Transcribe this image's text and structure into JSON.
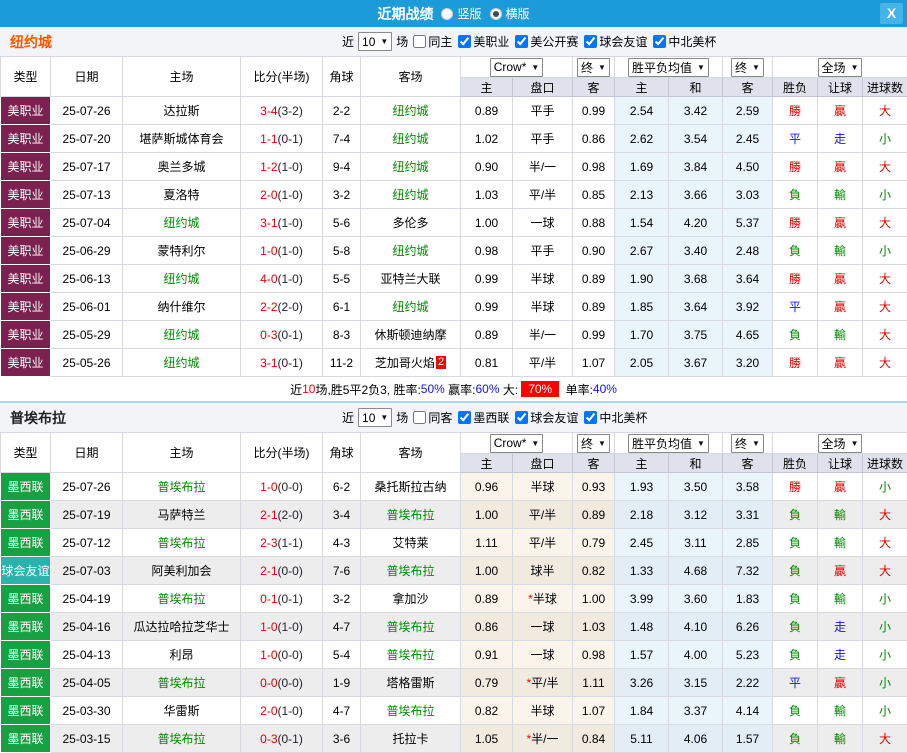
{
  "topbar": {
    "title": "近期战绩",
    "radios": [
      {
        "label": "竖版",
        "checked": false
      },
      {
        "label": "横版",
        "checked": true
      }
    ],
    "close": "X",
    "bg_color": "#1b9cd8"
  },
  "palette": {
    "r": "#e60000",
    "b": "#1414e6",
    "g": "#008a00"
  },
  "table_header": {
    "cols": [
      "类型",
      "日期",
      "主场",
      "比分(半场)",
      "角球",
      "客场"
    ],
    "sub": [
      "主",
      "盘口",
      "客",
      "主",
      "和",
      "客",
      "胜负",
      "让球",
      "进球数"
    ],
    "dropdowns": [
      "Crow*",
      "终",
      "胜平负均值",
      "终",
      "全场"
    ]
  },
  "sections": [
    {
      "team": "纽约城",
      "team_style": "color:#ff5500;",
      "filters": {
        "near": "近",
        "count": "10",
        "games": "场",
        "same_label": "同主",
        "same_checked": false,
        "comps": [
          {
            "label": "美职业",
            "checked": true
          },
          {
            "label": "美公开赛",
            "checked": true
          },
          {
            "label": "球会友谊",
            "checked": true
          },
          {
            "label": "中北美杯",
            "checked": true
          }
        ]
      },
      "rows": [
        {
          "type": "美职业",
          "type_color": "#7b2150",
          "date": "25-07-26",
          "home": "达拉斯",
          "home_self": false,
          "ft": "3-4",
          "ht": "(3-2)",
          "corner": "2-2",
          "away": "纽约城",
          "away_self": true,
          "badge": "",
          "o1": "0.89",
          "hc": "平手",
          "o2": "0.99",
          "m1": "2.54",
          "m2": "3.42",
          "m3": "2.59",
          "r": [
            [
              "勝",
              "r"
            ],
            [
              "贏",
              "r"
            ],
            [
              "大",
              "r"
            ]
          ]
        },
        {
          "type": "美职业",
          "type_color": "#7b2150",
          "date": "25-07-20",
          "home": "堪萨斯城体育会",
          "home_self": false,
          "ft": "1-1",
          "ht": "(0-1)",
          "corner": "7-4",
          "away": "纽约城",
          "away_self": true,
          "badge": "",
          "o1": "1.02",
          "hc": "平手",
          "o2": "0.86",
          "m1": "2.62",
          "m2": "3.54",
          "m3": "2.45",
          "r": [
            [
              "平",
              "b"
            ],
            [
              "走",
              "b"
            ],
            [
              "小",
              "g"
            ]
          ]
        },
        {
          "type": "美职业",
          "type_color": "#7b2150",
          "date": "25-07-17",
          "home": "奥兰多城",
          "home_self": false,
          "ft": "1-2",
          "ht": "(1-0)",
          "corner": "9-4",
          "away": "纽约城",
          "away_self": true,
          "badge": "",
          "o1": "0.90",
          "hc": "半/一",
          "o2": "0.98",
          "m1": "1.69",
          "m2": "3.84",
          "m3": "4.50",
          "r": [
            [
              "勝",
              "r"
            ],
            [
              "贏",
              "r"
            ],
            [
              "大",
              "r"
            ]
          ]
        },
        {
          "type": "美职业",
          "type_color": "#7b2150",
          "date": "25-07-13",
          "home": "夏洛特",
          "home_self": false,
          "ft": "2-0",
          "ht": "(1-0)",
          "corner": "3-2",
          "away": "纽约城",
          "away_self": true,
          "badge": "",
          "o1": "1.03",
          "hc": "平/半",
          "o2": "0.85",
          "m1": "2.13",
          "m2": "3.66",
          "m3": "3.03",
          "r": [
            [
              "負",
              "g"
            ],
            [
              "輸",
              "g"
            ],
            [
              "小",
              "g"
            ]
          ]
        },
        {
          "type": "美职业",
          "type_color": "#7b2150",
          "date": "25-07-04",
          "home": "纽约城",
          "home_self": true,
          "ft": "3-1",
          "ht": "(1-0)",
          "corner": "5-6",
          "away": "多伦多",
          "away_self": false,
          "badge": "",
          "o1": "1.00",
          "hc": "一球",
          "o2": "0.88",
          "m1": "1.54",
          "m2": "4.20",
          "m3": "5.37",
          "r": [
            [
              "勝",
              "r"
            ],
            [
              "贏",
              "r"
            ],
            [
              "大",
              "r"
            ]
          ]
        },
        {
          "type": "美职业",
          "type_color": "#7b2150",
          "date": "25-06-29",
          "home": "蒙特利尔",
          "home_self": false,
          "ft": "1-0",
          "ht": "(1-0)",
          "corner": "5-8",
          "away": "纽约城",
          "away_self": true,
          "badge": "",
          "o1": "0.98",
          "hc": "平手",
          "o2": "0.90",
          "m1": "2.67",
          "m2": "3.40",
          "m3": "2.48",
          "r": [
            [
              "負",
              "g"
            ],
            [
              "輸",
              "g"
            ],
            [
              "小",
              "g"
            ]
          ]
        },
        {
          "type": "美职业",
          "type_color": "#7b2150",
          "date": "25-06-13",
          "home": "纽约城",
          "home_self": true,
          "ft": "4-0",
          "ht": "(1-0)",
          "corner": "5-5",
          "away": "亚特兰大联",
          "away_self": false,
          "badge": "",
          "o1": "0.99",
          "hc": "半球",
          "o2": "0.89",
          "m1": "1.90",
          "m2": "3.68",
          "m3": "3.64",
          "r": [
            [
              "勝",
              "r"
            ],
            [
              "贏",
              "r"
            ],
            [
              "大",
              "r"
            ]
          ]
        },
        {
          "type": "美职业",
          "type_color": "#7b2150",
          "date": "25-06-01",
          "home": "纳什维尔",
          "home_self": false,
          "ft": "2-2",
          "ht": "(2-0)",
          "corner": "6-1",
          "away": "纽约城",
          "away_self": true,
          "badge": "",
          "o1": "0.99",
          "hc": "半球",
          "o2": "0.89",
          "m1": "1.85",
          "m2": "3.64",
          "m3": "3.92",
          "r": [
            [
              "平",
              "b"
            ],
            [
              "贏",
              "r"
            ],
            [
              "大",
              "r"
            ]
          ]
        },
        {
          "type": "美职业",
          "type_color": "#7b2150",
          "date": "25-05-29",
          "home": "纽约城",
          "home_self": true,
          "ft": "0-3",
          "ht": "(0-1)",
          "corner": "8-3",
          "away": "休斯顿迪纳摩",
          "away_self": false,
          "badge": "",
          "o1": "0.89",
          "hc": "半/一",
          "o2": "0.99",
          "m1": "1.70",
          "m2": "3.75",
          "m3": "4.65",
          "r": [
            [
              "負",
              "g"
            ],
            [
              "輸",
              "g"
            ],
            [
              "大",
              "r"
            ]
          ]
        },
        {
          "type": "美职业",
          "type_color": "#7b2150",
          "date": "25-05-26",
          "home": "纽约城",
          "home_self": true,
          "ft": "3-1",
          "ht": "(0-1)",
          "corner": "11-2",
          "away": "芝加哥火焰",
          "away_self": false,
          "badge": "2",
          "o1": "0.81",
          "hc": "平/半",
          "o2": "1.07",
          "m1": "2.05",
          "m2": "3.67",
          "m3": "3.20",
          "r": [
            [
              "勝",
              "r"
            ],
            [
              "贏",
              "r"
            ],
            [
              "大",
              "r"
            ]
          ]
        }
      ],
      "summary": [
        {
          "t": "近",
          "c": "k"
        },
        {
          "t": "10",
          "c": "r"
        },
        {
          "t": "场,胜5平2负3, 胜率:",
          "c": "k"
        },
        {
          "t": "50%",
          "c": "b"
        },
        {
          "t": " 赢率:",
          "c": "k"
        },
        {
          "t": "60%",
          "c": "b"
        },
        {
          "t": " 大:",
          "c": "k"
        },
        {
          "t": "70%",
          "c": "hl"
        },
        {
          "t": " 单率:",
          "c": "k"
        },
        {
          "t": "40%",
          "c": "b"
        }
      ]
    },
    {
      "team": "普埃布拉",
      "team_style": "color:#222222;",
      "filters": {
        "near": "近",
        "count": "10",
        "games": "场",
        "same_label": "同客",
        "same_checked": false,
        "comps": [
          {
            "label": "墨西联",
            "checked": true
          },
          {
            "label": "球会友谊",
            "checked": true
          },
          {
            "label": "中北美杯",
            "checked": true
          }
        ]
      },
      "rows": [
        {
          "type": "墨西联",
          "type_color": "#17a143",
          "date": "25-07-26",
          "home": "普埃布拉",
          "home_self": true,
          "ft": "1-0",
          "ht": "(0-0)",
          "corner": "6-2",
          "away": "桑托斯拉古纳",
          "away_self": false,
          "badge": "",
          "o1": "0.96",
          "hc": "半球",
          "o2": "0.93",
          "m1": "1.93",
          "m2": "3.50",
          "m3": "3.58",
          "r": [
            [
              "勝",
              "r"
            ],
            [
              "贏",
              "r"
            ],
            [
              "小",
              "g"
            ]
          ]
        },
        {
          "type": "墨西联",
          "type_color": "#17a143",
          "date": "25-07-19",
          "home": "马萨特兰",
          "home_self": false,
          "ft": "2-1",
          "ht": "(2-0)",
          "corner": "3-4",
          "away": "普埃布拉",
          "away_self": true,
          "badge": "",
          "o1": "1.00",
          "hc": "平/半",
          "o2": "0.89",
          "m1": "2.18",
          "m2": "3.12",
          "m3": "3.31",
          "r": [
            [
              "負",
              "g"
            ],
            [
              "輸",
              "g"
            ],
            [
              "大",
              "r"
            ]
          ]
        },
        {
          "type": "墨西联",
          "type_color": "#17a143",
          "date": "25-07-12",
          "home": "普埃布拉",
          "home_self": true,
          "ft": "2-3",
          "ht": "(1-1)",
          "corner": "4-3",
          "away": "艾特莱",
          "away_self": false,
          "badge": "",
          "o1": "1.11",
          "hc": "平/半",
          "o2": "0.79",
          "m1": "2.45",
          "m2": "3.11",
          "m3": "2.85",
          "r": [
            [
              "負",
              "g"
            ],
            [
              "輸",
              "g"
            ],
            [
              "大",
              "r"
            ]
          ]
        },
        {
          "type": "球会友谊",
          "type_color": "#2ab3ad",
          "date": "25-07-03",
          "home": "阿美利加会",
          "home_self": false,
          "ft": "2-1",
          "ht": "(0-0)",
          "corner": "7-6",
          "away": "普埃布拉",
          "away_self": true,
          "badge": "",
          "o1": "1.00",
          "hc": "球半",
          "o2": "0.82",
          "m1": "1.33",
          "m2": "4.68",
          "m3": "7.32",
          "r": [
            [
              "負",
              "g"
            ],
            [
              "贏",
              "r"
            ],
            [
              "大",
              "r"
            ]
          ]
        },
        {
          "type": "墨西联",
          "type_color": "#17a143",
          "date": "25-04-19",
          "home": "普埃布拉",
          "home_self": true,
          "ft": "0-1",
          "ht": "(0-1)",
          "corner": "3-2",
          "away": "拿加沙",
          "away_self": false,
          "badge": "",
          "o1": "0.89",
          "hc": "*半球",
          "o2": "1.00",
          "m1": "3.99",
          "m2": "3.60",
          "m3": "1.83",
          "r": [
            [
              "負",
              "g"
            ],
            [
              "輸",
              "g"
            ],
            [
              "小",
              "g"
            ]
          ]
        },
        {
          "type": "墨西联",
          "type_color": "#17a143",
          "date": "25-04-16",
          "home": "瓜达拉哈拉芝华士",
          "home_self": false,
          "ft": "1-0",
          "ht": "(1-0)",
          "corner": "4-7",
          "away": "普埃布拉",
          "away_self": true,
          "badge": "",
          "o1": "0.86",
          "hc": "一球",
          "o2": "1.03",
          "m1": "1.48",
          "m2": "4.10",
          "m3": "6.26",
          "r": [
            [
              "負",
              "g"
            ],
            [
              "走",
              "b"
            ],
            [
              "小",
              "g"
            ]
          ]
        },
        {
          "type": "墨西联",
          "type_color": "#17a143",
          "date": "25-04-13",
          "home": "利昂",
          "home_self": false,
          "ft": "1-0",
          "ht": "(0-0)",
          "corner": "5-4",
          "away": "普埃布拉",
          "away_self": true,
          "badge": "",
          "o1": "0.91",
          "hc": "一球",
          "o2": "0.98",
          "m1": "1.57",
          "m2": "4.00",
          "m3": "5.23",
          "r": [
            [
              "負",
              "g"
            ],
            [
              "走",
              "b"
            ],
            [
              "小",
              "g"
            ]
          ]
        },
        {
          "type": "墨西联",
          "type_color": "#17a143",
          "date": "25-04-05",
          "home": "普埃布拉",
          "home_self": true,
          "ft": "0-0",
          "ht": "(0-0)",
          "corner": "1-9",
          "away": "塔格雷斯",
          "away_self": false,
          "badge": "",
          "o1": "0.79",
          "hc": "*平/半",
          "o2": "1.11",
          "m1": "3.26",
          "m2": "3.15",
          "m3": "2.22",
          "r": [
            [
              "平",
              "b"
            ],
            [
              "贏",
              "r"
            ],
            [
              "小",
              "g"
            ]
          ]
        },
        {
          "type": "墨西联",
          "type_color": "#17a143",
          "date": "25-03-30",
          "home": "华雷斯",
          "home_self": false,
          "ft": "2-0",
          "ht": "(1-0)",
          "corner": "4-7",
          "away": "普埃布拉",
          "away_self": true,
          "badge": "",
          "o1": "0.82",
          "hc": "半球",
          "o2": "1.07",
          "m1": "1.84",
          "m2": "3.37",
          "m3": "4.14",
          "r": [
            [
              "負",
              "g"
            ],
            [
              "輸",
              "g"
            ],
            [
              "小",
              "g"
            ]
          ]
        },
        {
          "type": "墨西联",
          "type_color": "#17a143",
          "date": "25-03-15",
          "home": "普埃布拉",
          "home_self": true,
          "ft": "0-3",
          "ht": "(0-1)",
          "corner": "3-6",
          "away": "托拉卡",
          "away_self": false,
          "badge": "",
          "o1": "1.05",
          "hc": "*半/一",
          "o2": "0.84",
          "m1": "5.11",
          "m2": "4.06",
          "m3": "1.57",
          "r": [
            [
              "負",
              "g"
            ],
            [
              "輸",
              "g"
            ],
            [
              "大",
              "r"
            ]
          ]
        }
      ],
      "summary": null
    }
  ]
}
